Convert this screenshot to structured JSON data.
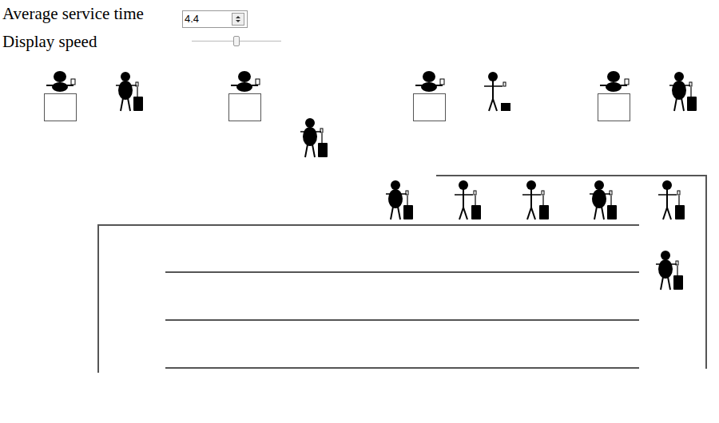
{
  "controls": {
    "service_time": {
      "label": "Average service time",
      "value": "4.4"
    },
    "display_speed": {
      "label": "Display speed",
      "level": 0.5
    }
  },
  "desks": [
    {
      "occupied": true,
      "kind": "round"
    },
    {
      "occupied": false
    },
    {
      "occupied": true,
      "kind": "thin-box"
    },
    {
      "occupied": true,
      "kind": "round"
    }
  ],
  "walking": [
    {
      "kind": "round"
    }
  ],
  "queue": [
    {
      "kind": "round"
    },
    {
      "kind": "thin"
    },
    {
      "kind": "thin"
    },
    {
      "kind": "round"
    },
    {
      "kind": "thin"
    },
    {
      "kind": "round"
    }
  ]
}
